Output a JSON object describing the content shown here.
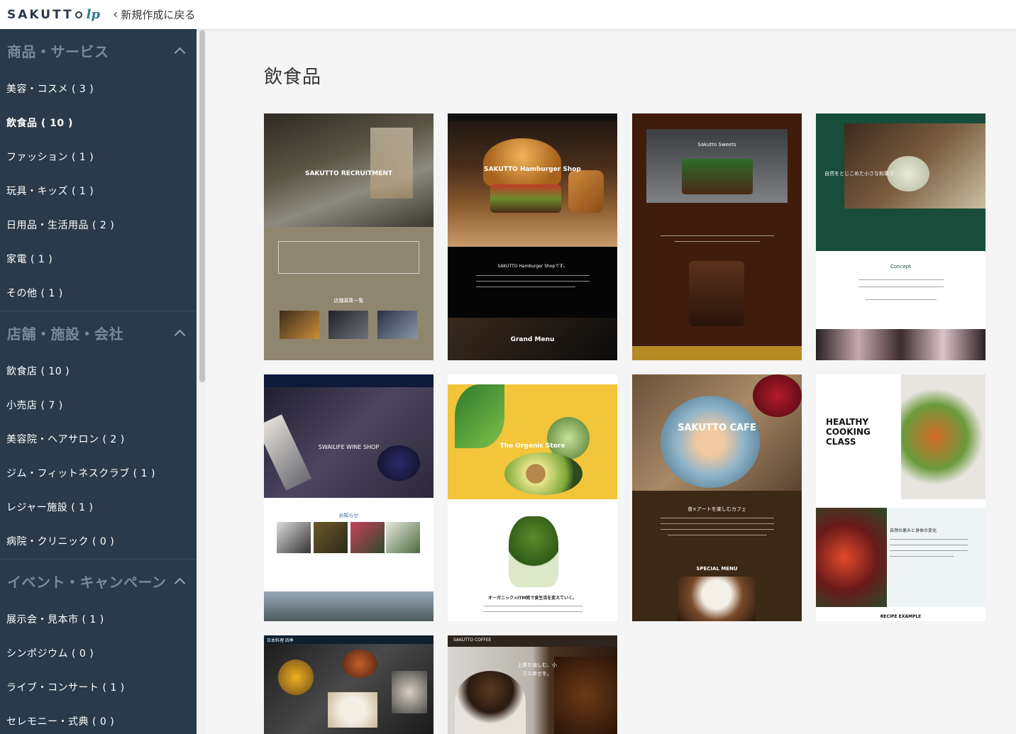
{
  "header": {
    "logo_text": "SAKUTT",
    "logo_suffix": "lp",
    "back_label": "新規作成に戻る"
  },
  "sidebar": {
    "groups": [
      {
        "title": "商品・サービス",
        "items": [
          {
            "label": "美容・コスメ ( 3 )"
          },
          {
            "label": "飲食品 ( 10 )"
          },
          {
            "label": "ファッション ( 1 )"
          },
          {
            "label": "玩具・キッズ ( 1 )"
          },
          {
            "label": "日用品・生活用品 ( 2 )"
          },
          {
            "label": "家電 ( 1 )"
          },
          {
            "label": "その他 ( 1 )"
          }
        ]
      },
      {
        "title": "店舗・施設・会社",
        "items": [
          {
            "label": "飲食店 ( 10 )"
          },
          {
            "label": "小売店 ( 7 )"
          },
          {
            "label": "美容院・ヘアサロン ( 2 )"
          },
          {
            "label": "ジム・フィットネスクラブ ( 1 )"
          },
          {
            "label": "レジャー施設 ( 1 )"
          },
          {
            "label": "病院・クリニック ( 0 )"
          }
        ]
      },
      {
        "title": "イベント・キャンペーン",
        "items": [
          {
            "label": "展示会・見本市 ( 1 )"
          },
          {
            "label": "シンポジウム ( 0 )"
          },
          {
            "label": "ライブ・コンサート ( 1 )"
          },
          {
            "label": "セレモニー・式典 ( 0 )"
          }
        ]
      }
    ]
  },
  "main": {
    "title": "飲食品",
    "templates": [
      {
        "headline": "SAKUTTO RECRUITMENT",
        "sub": "店舗募集一覧"
      },
      {
        "headline": "SAKUTTO Hamburger Shop",
        "sub": "Grand Menu",
        "intro": "SAKUTTO Hamburger Shopです。"
      },
      {
        "headline": "Sakutto Sweets"
      },
      {
        "headline": "自然をとじこめた小さな和菓子",
        "sub": "Concept"
      },
      {
        "headline": "SWAILIFE WINE SHOP",
        "sub": "お知らせ"
      },
      {
        "headline": "The Organic Store",
        "sub": "オーガニック×ITM術で食生活を変えていく。"
      },
      {
        "headline": "SAKUTTO CAFE",
        "sub": "SPECIAL MENU",
        "intro": "食×アートを楽しむカフェ"
      },
      {
        "headline": "HEALTHY COOKING CLASS",
        "sub": "RECIPE EXAMPLE",
        "intro": "自然の恵みと身体の変化"
      },
      {
        "headline": "日本料理 四季"
      },
      {
        "headline": "SAKUTTO COFFEE",
        "intro": "上質を愉しむ、小さな幸せを。"
      }
    ]
  },
  "colors": {
    "sidebar_bg": "#2b3a4a",
    "group_title": "#7c8896",
    "page_bg": "#f5f5f5"
  }
}
